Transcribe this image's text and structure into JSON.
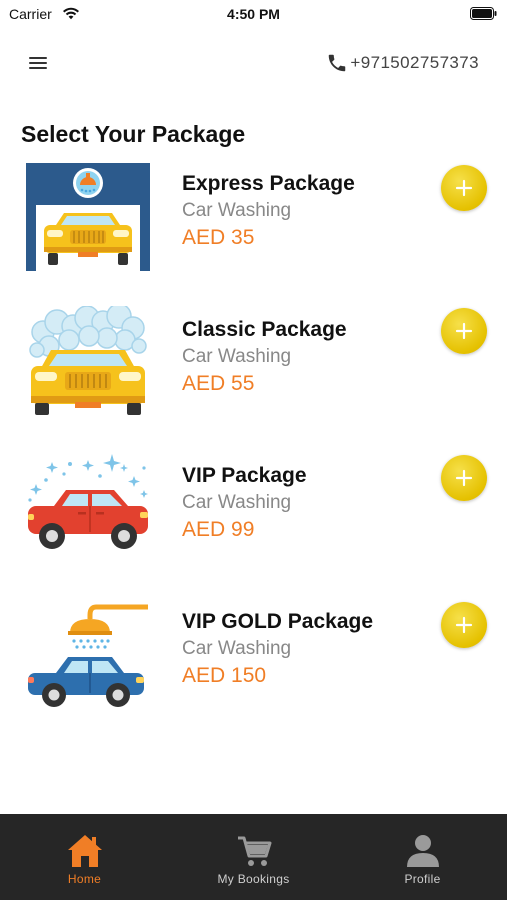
{
  "status_bar": {
    "carrier": "Carrier",
    "time": "4:50 PM"
  },
  "header": {
    "menu_icon": "hamburger-menu-icon",
    "phone_icon": "phone-icon",
    "phone_number": "+971502757373"
  },
  "title": "Select Your Package",
  "packages": [
    {
      "name": "Express Package",
      "category": "Car Washing",
      "price": "AED 35",
      "image": "car-wash-garage-illustration"
    },
    {
      "name": "Classic Package",
      "category": "Car Washing",
      "price": "AED 55",
      "image": "car-foam-wash-illustration"
    },
    {
      "name": "VIP Package",
      "category": "Car Washing",
      "price": "AED 99",
      "image": "sparkling-red-car-illustration"
    },
    {
      "name": "VIP GOLD Package",
      "category": "Car Washing",
      "price": "AED 150",
      "image": "car-under-shower-illustration"
    }
  ],
  "add_button_icon": "plus-icon",
  "bottom_nav": {
    "items": [
      {
        "label": "Home",
        "icon": "home-icon",
        "active": true
      },
      {
        "label": "My Bookings",
        "icon": "cart-icon",
        "active": false
      },
      {
        "label": "Profile",
        "icon": "user-icon",
        "active": false
      }
    ]
  },
  "colors": {
    "accent_orange": "#f07e26",
    "add_button_yellow": "#e5c100",
    "nav_background": "#262626",
    "subtitle_gray": "#888888"
  }
}
